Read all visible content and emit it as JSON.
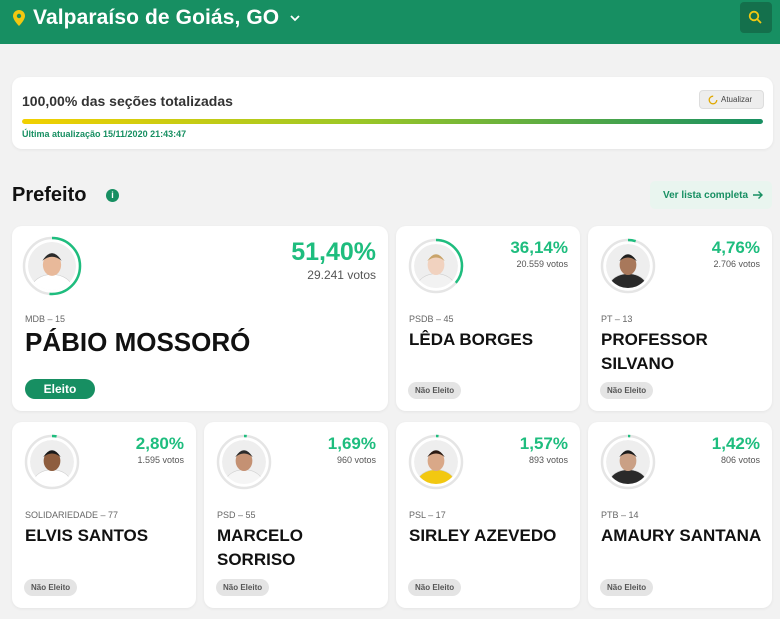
{
  "header": {
    "city": "Valparaíso de Goiás, GO"
  },
  "status": {
    "sections_text": "100,00% das seções totalizadas",
    "refresh_label": "Atualizar",
    "progress_percent": 100,
    "last_update": "Última atualização 15/11/2020 21:43:47"
  },
  "section": {
    "title": "Prefeito",
    "see_all": "Ver lista completa"
  },
  "colors": {
    "brand": "#178f62",
    "percent": "#1ebd7e",
    "elected_badge": "#178f62"
  },
  "candidates": [
    {
      "party": "MDB – 15",
      "name": "PÁBIO MOSSORÓ",
      "percent": "51,40%",
      "votes": "29.241 votos",
      "status": "Eleito",
      "share": 51.4
    },
    {
      "party": "PSDB – 45",
      "name": "LÊDA BORGES",
      "percent": "36,14%",
      "votes": "20.559 votos",
      "status": "Não Eleito",
      "share": 36.14
    },
    {
      "party": "PT – 13",
      "name": "PROFESSOR SILVANO",
      "percent": "4,76%",
      "votes": "2.706 votos",
      "status": "Não Eleito",
      "share": 4.76
    },
    {
      "party": "SOLIDARIEDADE – 77",
      "name": "ELVIS SANTOS",
      "percent": "2,80%",
      "votes": "1.595 votos",
      "status": "Não Eleito",
      "share": 2.8
    },
    {
      "party": "PSD – 55",
      "name": "MARCELO SORRISO",
      "percent": "1,69%",
      "votes": "960 votos",
      "status": "Não Eleito",
      "share": 1.69
    },
    {
      "party": "PSL – 17",
      "name": "SIRLEY AZEVEDO",
      "percent": "1,57%",
      "votes": "893 votos",
      "status": "Não Eleito",
      "share": 1.57
    },
    {
      "party": "PTB – 14",
      "name": "AMAURY SANTANA",
      "percent": "1,42%",
      "votes": "806 votos",
      "status": "Não Eleito",
      "share": 1.42
    }
  ]
}
